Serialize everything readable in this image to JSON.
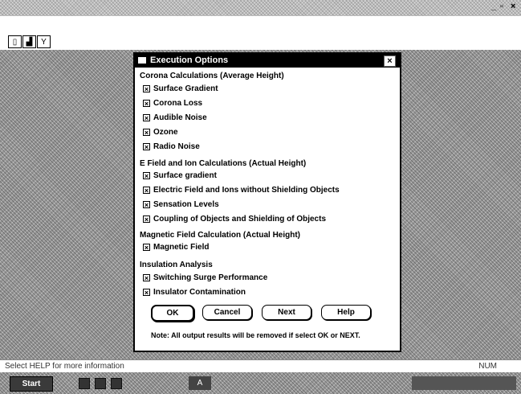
{
  "window": {
    "controls": [
      "_",
      "▫",
      "×"
    ]
  },
  "toolbar": {
    "icons": [
      "open-file-icon",
      "chart-icon",
      "tower-icon"
    ]
  },
  "status_bar": {
    "hint": "Select HELP for more information",
    "indicator": "NUM"
  },
  "taskbar": {
    "start_label": "Start",
    "app_label": "A"
  },
  "dialog": {
    "title": "Execution Options",
    "close_label": "×",
    "sections": [
      {
        "title": "Corona Calculations (Average Height)",
        "options": [
          {
            "label": "Surface Gradient",
            "checked": true
          },
          {
            "label": "Corona Loss",
            "checked": true
          },
          {
            "label": "Audible Noise",
            "checked": true
          },
          {
            "label": "Ozone",
            "checked": true
          },
          {
            "label": "Radio Noise",
            "checked": true
          }
        ]
      },
      {
        "title": "E Field and Ion Calculations (Actual Height)",
        "options": [
          {
            "label": "Surface gradient",
            "checked": true
          },
          {
            "label": "Electric Field and Ions without Shielding Objects",
            "checked": true
          },
          {
            "label": "Sensation Levels",
            "checked": true
          },
          {
            "label": "Coupling of Objects and Shielding of Objects",
            "checked": true
          }
        ]
      },
      {
        "title": "Magnetic Field Calculation (Actual Height)",
        "options": [
          {
            "label": "Magnetic Field",
            "checked": true
          }
        ]
      },
      {
        "title": "Insulation Analysis",
        "options": [
          {
            "label": "Switching Surge Performance",
            "checked": true
          },
          {
            "label": "Insulator Contamination",
            "checked": true
          }
        ]
      }
    ],
    "buttons": {
      "ok": "OK",
      "cancel": "Cancel",
      "next": "Next",
      "help": "Help"
    },
    "note": "Note:  All output results will be removed if select OK or NEXT."
  }
}
